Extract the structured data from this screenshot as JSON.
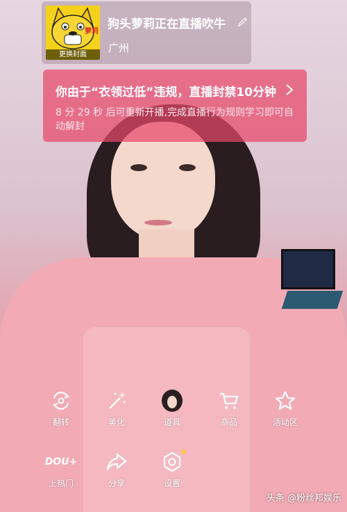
{
  "header": {
    "title": "狗头萝莉正在直播吹牛",
    "location": "广州",
    "avatar_badge": "萝莉",
    "avatar_change_label": "更换封面"
  },
  "notice": {
    "title": "你由于“衣领过低”违规，直播封禁10分钟",
    "body": "8 分 29 秒 后可重新开播,完成直播行为规则学习即可自动解封"
  },
  "controls": {
    "flip": {
      "label": "翻转",
      "icon": "flip-camera-icon"
    },
    "beauty": {
      "label": "美化",
      "icon": "magic-wand-icon"
    },
    "props": {
      "label": "道具",
      "icon": "sticker-icon"
    },
    "products": {
      "label": "商品",
      "icon": "cart-icon"
    },
    "activity": {
      "label": "活动区",
      "icon": "star-icon"
    },
    "dou": {
      "label": "上热门",
      "brand": "DOU+"
    },
    "share": {
      "label": "分享",
      "icon": "share-icon"
    },
    "settings": {
      "label": "设置",
      "icon": "hexagon-settings-icon"
    }
  },
  "watermark": "头条 @粉丝邦娱乐",
  "colors": {
    "notice_bg": "#e8486a",
    "avatar_bg": "#f4d21a",
    "settings_dot": "#f7c84a"
  }
}
